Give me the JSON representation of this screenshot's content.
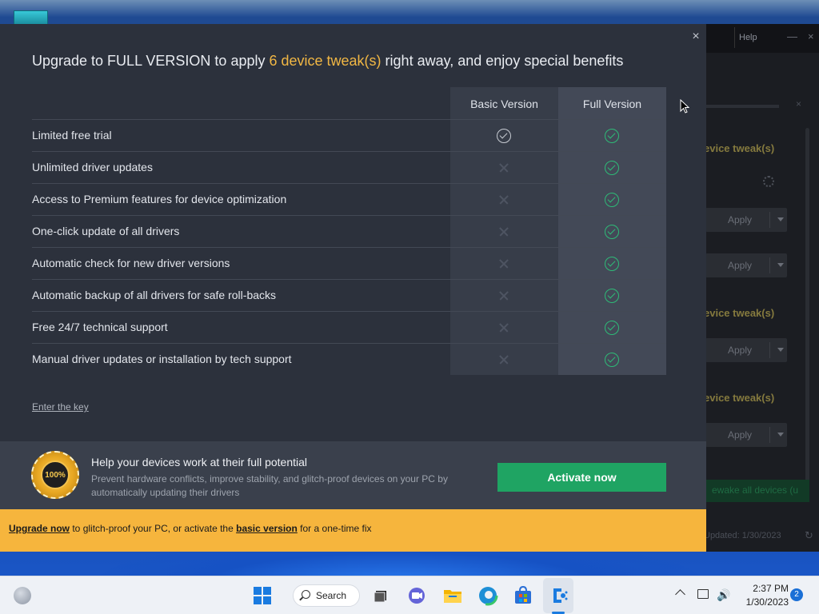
{
  "dialog": {
    "title_prefix": "Upgrade to FULL VERSION to apply ",
    "title_highlight": "6 device tweak(s)",
    "title_suffix": " right away, and enjoy special benefits",
    "close_icon": "×",
    "columns": {
      "basic": "Basic Version",
      "full": "Full Version"
    },
    "features": [
      {
        "label": "Limited free trial",
        "basic": "check",
        "full": "check"
      },
      {
        "label": "Unlimited driver updates",
        "basic": "cross",
        "full": "check"
      },
      {
        "label": "Access to Premium features for device optimization",
        "basic": "cross",
        "full": "check"
      },
      {
        "label": "One-click update of all drivers",
        "basic": "cross",
        "full": "check"
      },
      {
        "label": "Automatic check for new driver versions",
        "basic": "cross",
        "full": "check"
      },
      {
        "label": "Automatic backup of all drivers for safe roll-backs",
        "basic": "cross",
        "full": "check"
      },
      {
        "label": "Free 24/7 technical support",
        "basic": "cross",
        "full": "check"
      },
      {
        "label": "Manual driver updates or installation by tech support",
        "basic": "cross",
        "full": "check"
      }
    ],
    "enter_key": "Enter the key",
    "promo": {
      "seal_text": "100%",
      "title": "Help your devices work at their full potential",
      "subtitle": "Prevent hardware conflicts, improve stability, and glitch-proof devices on your PC by automatically updating their drivers",
      "activate_label": "Activate now"
    },
    "banner": {
      "link1": "Upgrade now",
      "middle": " to glitch-proof your PC, or activate the ",
      "link2": "basic version",
      "end": " for a one-time fix"
    }
  },
  "background_window": {
    "help": "Help",
    "minimize_icon": "—",
    "close_icon": "×",
    "headings": [
      "evice tweak(s)",
      "evice tweak(s)",
      "evice tweak(s)"
    ],
    "apply_label": "Apply",
    "green_button": "ewake all devices (u",
    "updated": "Updated: 1/30/2023"
  },
  "taskbar": {
    "search_label": "Search",
    "time": "2:37 PM",
    "date": "1/30/2023",
    "notifications": "2",
    "volume_icon": "🔊"
  },
  "colors": {
    "accent_orange": "#f1b744",
    "activate_green": "#1fa463",
    "banner_yellow": "#f6b53d",
    "check_green": "#2ebc78"
  }
}
